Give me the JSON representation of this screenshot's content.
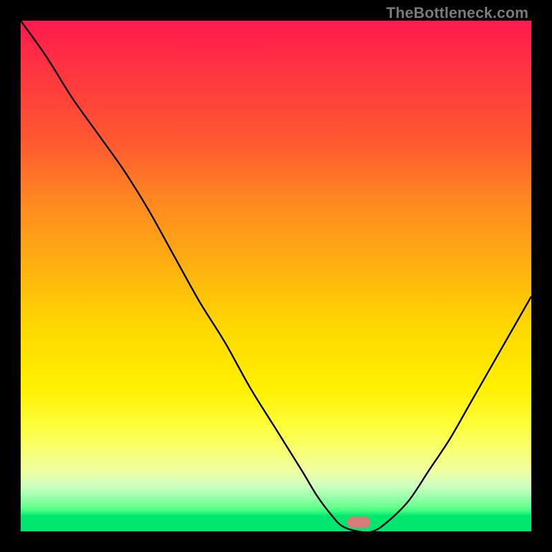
{
  "watermark": "TheBottleneck.com",
  "marker": {
    "x_frac": 0.662,
    "y_frac": 0.983,
    "color": "#d87a7a"
  },
  "chart_data": {
    "type": "line",
    "title": "",
    "xlabel": "",
    "ylabel": "",
    "xlim": [
      0,
      1
    ],
    "ylim": [
      0,
      1
    ],
    "x": [
      0.0,
      0.05,
      0.1,
      0.15,
      0.2,
      0.25,
      0.3,
      0.35,
      0.4,
      0.45,
      0.5,
      0.55,
      0.58,
      0.61,
      0.63,
      0.66,
      0.69,
      0.72,
      0.76,
      0.8,
      0.84,
      0.88,
      0.92,
      0.96,
      1.0
    ],
    "values": [
      1.0,
      0.93,
      0.85,
      0.78,
      0.71,
      0.63,
      0.54,
      0.45,
      0.37,
      0.28,
      0.2,
      0.12,
      0.07,
      0.03,
      0.01,
      0.0,
      0.0,
      0.02,
      0.06,
      0.12,
      0.18,
      0.25,
      0.32,
      0.39,
      0.46
    ],
    "grid": false,
    "legend": false,
    "background_gradient": [
      "#ff1a4d",
      "#ffd800",
      "#fdff40",
      "#00e66e"
    ],
    "marker_point": {
      "x": 0.662,
      "y": 0.0
    }
  }
}
